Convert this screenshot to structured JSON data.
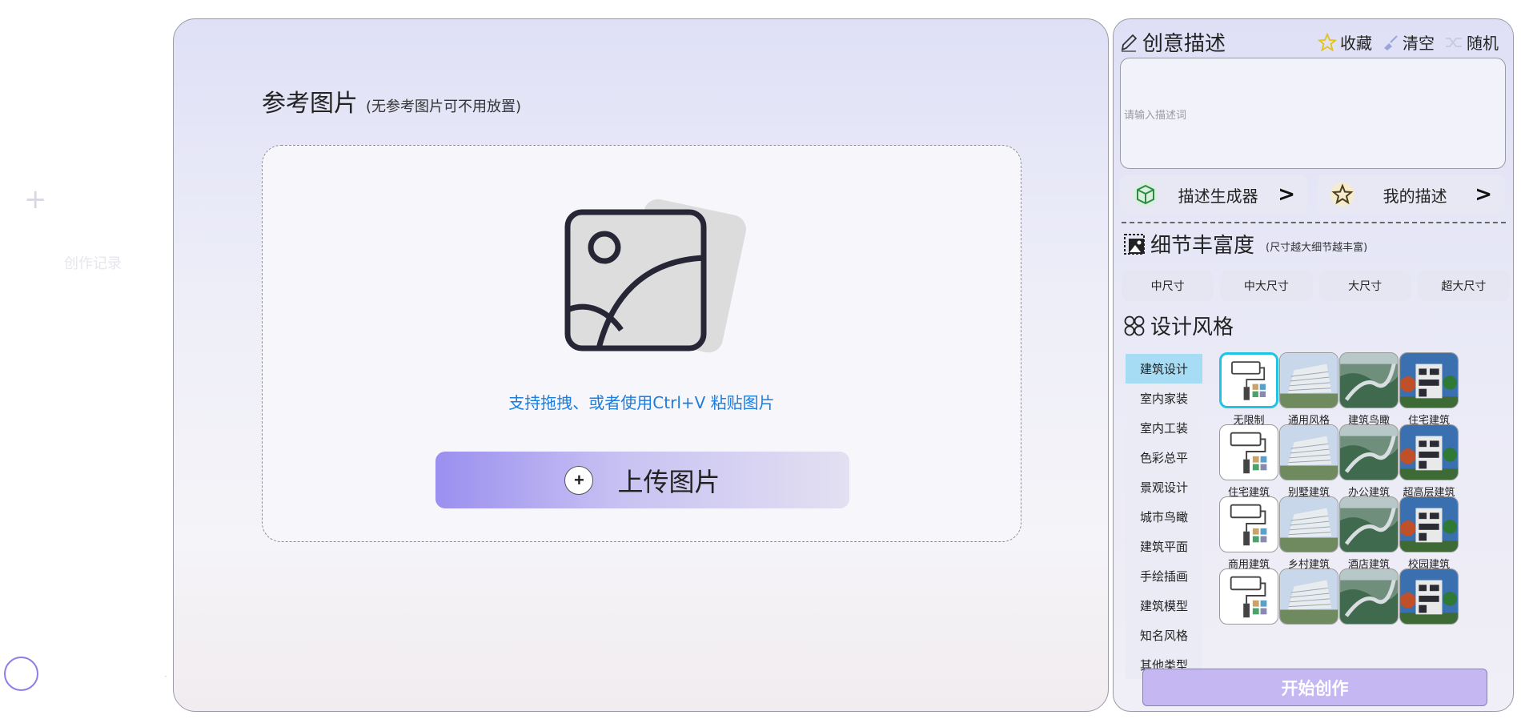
{
  "rail": {
    "new_icon": "plus-icon",
    "history_label": "创作记录"
  },
  "main": {
    "ref_title": "参考图片",
    "ref_subtitle": "(无参考图片可不用放置)",
    "drop_hint": "支持拖拽、或者使用Ctrl+V 粘贴图片",
    "upload_label": "上传图片"
  },
  "right": {
    "desc_title": "创意描述",
    "tools": {
      "favorite": "收藏",
      "clear": "清空",
      "random": "随机"
    },
    "desc_placeholder": "请输入描述词",
    "generator_label": "描述生成器",
    "my_desc_label": "我的描述",
    "detail_title": "细节丰富度",
    "detail_sub": "(尺寸越大细节越丰富)",
    "sizes": [
      "中尺寸",
      "中大尺寸",
      "大尺寸",
      "超大尺寸"
    ],
    "style_title": "设计风格",
    "categories": [
      "建筑设计",
      "室内家装",
      "室内工装",
      "色彩总平",
      "景观设计",
      "城市鸟瞰",
      "建筑平面",
      "手绘插画",
      "建筑模型",
      "知名风格",
      "其他类型"
    ],
    "active_category": "建筑设计",
    "styles": [
      "无限制",
      "通用风格",
      "建筑鸟瞰",
      "住宅建筑",
      "住宅建筑",
      "别墅建筑",
      "办公建筑",
      "超高层建筑",
      "商用建筑",
      "乡村建筑",
      "酒店建筑",
      "校园建筑",
      "",
      "",
      "",
      ""
    ],
    "start_label": "开始创作"
  },
  "colors": {
    "accent": "#9b8ff0",
    "link": "#1a7de0",
    "selected": "#1fc3e6",
    "active_tab": "#a6dcf4"
  }
}
